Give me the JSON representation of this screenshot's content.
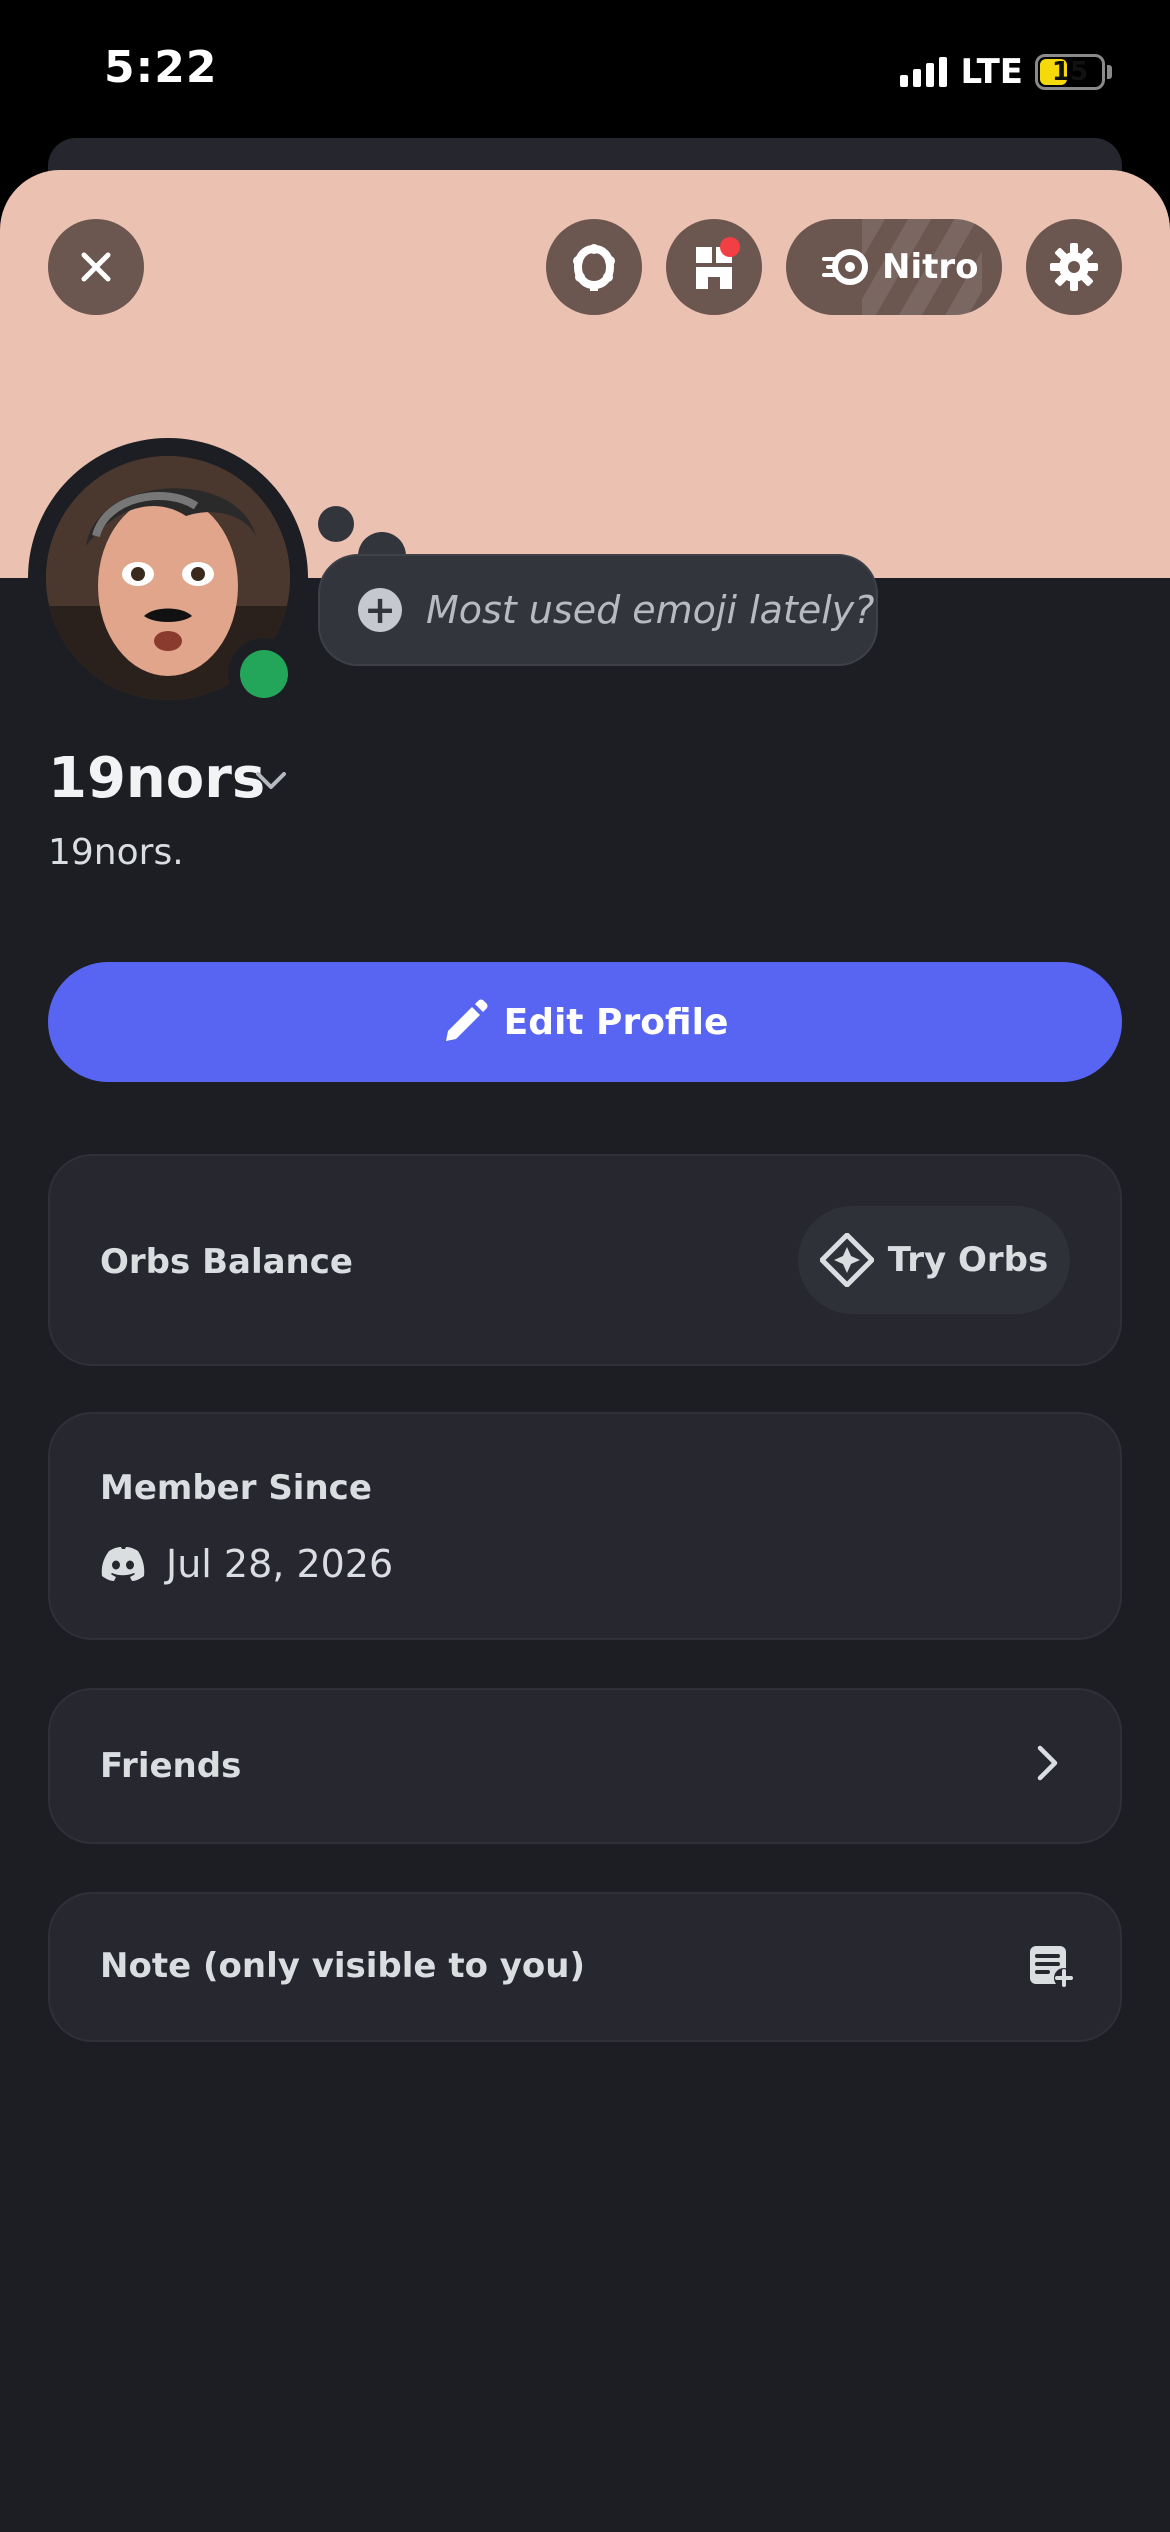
{
  "status_bar": {
    "time": "5:22",
    "network": "LTE",
    "battery": "15",
    "battery_level": 0.15
  },
  "header": {
    "close_icon": "close-icon",
    "icons": [
      "wreath-icon",
      "shop-icon",
      "nitro-icon",
      "gear-icon"
    ],
    "nitro_label": "Nitro"
  },
  "profile": {
    "display_name": "19nors",
    "username": "19nors.",
    "status_placeholder": "Most used emoji lately?",
    "online": true
  },
  "edit_profile": {
    "label": "Edit Profile"
  },
  "orbs": {
    "label": "Orbs Balance",
    "button_label": "Try Orbs"
  },
  "member": {
    "label": "Member Since",
    "date": "Jul 28, 2026"
  },
  "friends": {
    "label": "Friends"
  },
  "note": {
    "label": "Note (only visible to you)"
  },
  "colors": {
    "banner": "#ebc1b1",
    "accent": "#5865f2",
    "online": "#23a55a",
    "background": "#1d1e23"
  }
}
